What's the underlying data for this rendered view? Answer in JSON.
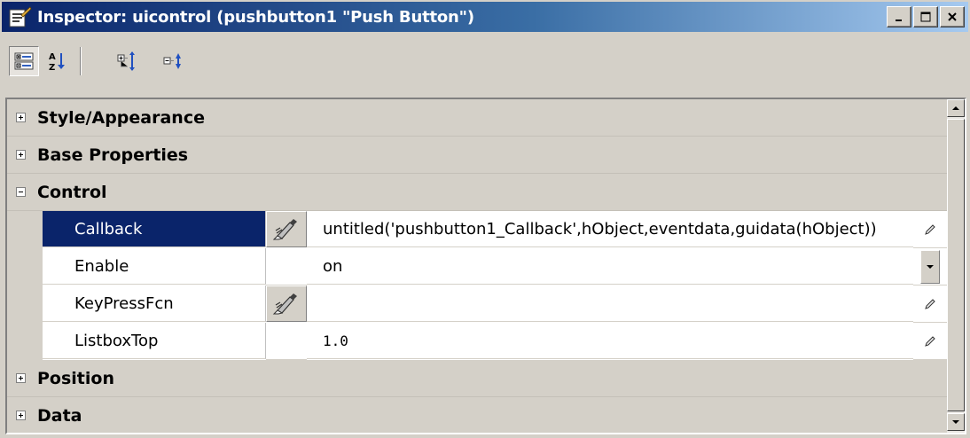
{
  "window": {
    "title": "Inspector:  uicontrol (pushbutton1 \"Push Button\")",
    "controls": [
      "minimize",
      "maximize",
      "close"
    ]
  },
  "toolbar": {
    "buttons": [
      {
        "name": "categorized-view",
        "icon": "category-view-icon",
        "pressed": true
      },
      {
        "name": "alphabetical-sort",
        "icon": "sort-az-icon",
        "pressed": false
      },
      {
        "name": "expand-all",
        "icon": "expand-all-icon",
        "pressed": false
      },
      {
        "name": "collapse-all",
        "icon": "collapse-all-icon",
        "pressed": false
      }
    ]
  },
  "grid": {
    "categories": {
      "style": {
        "label": "Style/Appearance",
        "expanded": false
      },
      "base": {
        "label": "Base Properties",
        "expanded": false
      },
      "control": {
        "label": "Control",
        "expanded": true
      },
      "position": {
        "label": "Position",
        "expanded": false
      },
      "data": {
        "label": "Data",
        "expanded": false
      }
    },
    "properties": {
      "callback": {
        "name": "Callback",
        "value": "untitled('pushbutton1_Callback',hObject,eventdata,guidata(hObject))"
      },
      "enable": {
        "name": "Enable",
        "value": "on"
      },
      "keypressfcn": {
        "name": "KeyPressFcn",
        "value": ""
      },
      "listboxtop": {
        "name": "ListboxTop",
        "value": "1.0"
      }
    },
    "selected_property": "Callback"
  },
  "colors": {
    "title_gradient_start": "#0a246a",
    "title_gradient_end": "#a6caf0",
    "selection": "#0a246a",
    "chrome": "#d4d0c8"
  }
}
